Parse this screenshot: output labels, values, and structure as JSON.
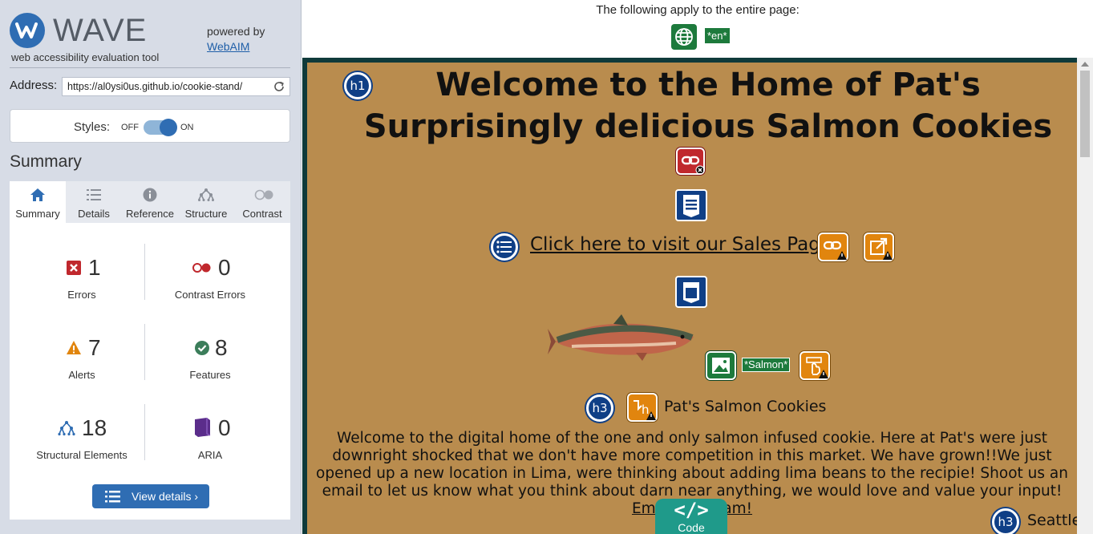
{
  "sidebar": {
    "logo_word": "WAVE",
    "tagline": "web accessibility evaluation tool",
    "powered_by": "powered by",
    "webaim_link": "WebAIM",
    "address_label": "Address:",
    "address_value": "https://al0ysi0us.github.io/cookie-stand/",
    "styles_label": "Styles:",
    "styles_off": "OFF",
    "styles_on": "ON",
    "styles_enabled": true,
    "summary_heading": "Summary",
    "tabs": [
      {
        "label": "Summary",
        "icon": "home-icon",
        "active": true
      },
      {
        "label": "Details",
        "icon": "list-icon",
        "active": false
      },
      {
        "label": "Reference",
        "icon": "info-icon",
        "active": false
      },
      {
        "label": "Structure",
        "icon": "hierarchy-icon",
        "active": false
      },
      {
        "label": "Contrast",
        "icon": "contrast-icon",
        "active": false
      }
    ],
    "stats": {
      "errors": {
        "count": "1",
        "label": "Errors"
      },
      "contrast_errors": {
        "count": "0",
        "label": "Contrast Errors"
      },
      "alerts": {
        "count": "7",
        "label": "Alerts"
      },
      "features": {
        "count": "8",
        "label": "Features"
      },
      "structural": {
        "count": "18",
        "label": "Structural Elements"
      },
      "aria": {
        "count": "0",
        "label": "ARIA"
      }
    },
    "view_details": "View details ›"
  },
  "topbar": {
    "apply_text": "The following apply to the entire page:",
    "lang_tag": "*en*"
  },
  "page": {
    "h1_badge": "h1",
    "title": "Welcome to the Home of Pat's Surprisingly delicious Salmon Cookies",
    "sales_link": "Click here to visit our Sales Page",
    "salmon_alt": "*Salmon*",
    "h3_badge": "h3",
    "h3_text": "Pat's Salmon Cookies",
    "intro_text": "Welcome to the digital home of the one and only salmon infused cookie. Here at Pat's were just downright shocked that we don't have more competition in this market. We have grown!!We just opened up a new location in Lima, were thinking about adding lima beans to the recipie! Shoot us an email to let us know what you think about darn near anything, we would love and value your input!",
    "email_link": "Email our Team!",
    "seattle_badge": "h3",
    "seattle_text": "Seattle"
  },
  "code_tab": {
    "glyph": "</>",
    "label": "Code"
  },
  "colors": {
    "sidebar_bg": "#d7dce6",
    "wave_blue": "#2f6db3",
    "error_red": "#c0282d",
    "alert_orange": "#e1850e",
    "feature_green": "#1d7a3c",
    "structure_blue": "#0f3f86",
    "aria_purple": "#5b2d8b",
    "page_bg": "#b98c4e",
    "code_teal": "#1f9a8a"
  }
}
